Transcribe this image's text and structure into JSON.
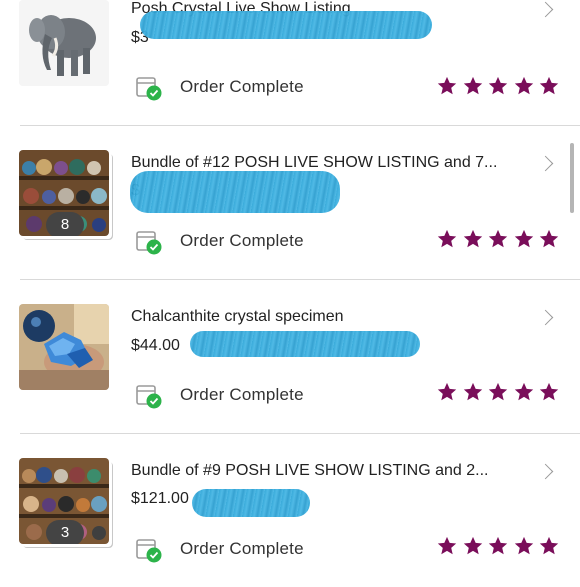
{
  "orders": [
    {
      "title": "Posh Crystal Live Show Listing",
      "price": "$3",
      "badge": "",
      "status": "Order Complete",
      "rating": 5,
      "thumbnail": "elephant-figurine"
    },
    {
      "title": "Bundle of #12 POSH LIVE SHOW LISTING and 7...",
      "price": "$",
      "badge": "8",
      "status": "Order Complete",
      "rating": 5,
      "thumbnail": "crystal-spheres-shelf"
    },
    {
      "title": "Chalcanthite crystal specimen",
      "price": "$44.00",
      "badge": "",
      "status": "Order Complete",
      "rating": 5,
      "thumbnail": "blue-chalcanthite-crystal"
    },
    {
      "title": "Bundle of #9 POSH LIVE SHOW LISTING and 2...",
      "price": "$121.00",
      "badge": "3",
      "status": "Order Complete",
      "rating": 5,
      "thumbnail": "crystal-spheres-shelf"
    }
  ],
  "colors": {
    "star": "#7a0e5a",
    "check": "#2cb34a",
    "redaction": "#2fa6d8",
    "divider": "#d9d9d9"
  },
  "icons": [
    "chevron-right-icon",
    "order-complete-icon",
    "star-icon"
  ]
}
